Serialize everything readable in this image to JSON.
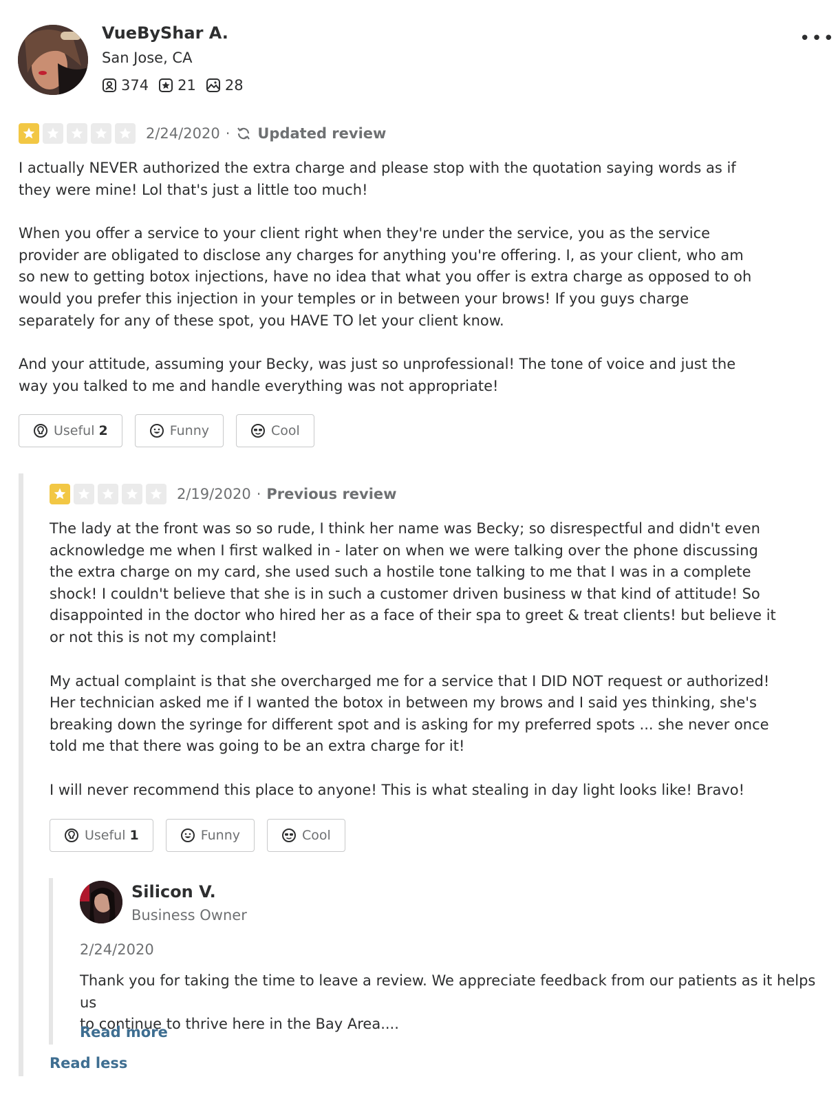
{
  "user": {
    "name": "VueByShar A.",
    "location": "San Jose, CA",
    "friends": "374",
    "reviews": "21",
    "photos": "28",
    "friends_icon": "friends-icon",
    "reviews_icon": "review-star-icon",
    "photos_icon": "photo-icon",
    "more_icon": "more-options-icon"
  },
  "colors": {
    "star_on": "#f2c744",
    "star_off": "#ebebeb",
    "link": "#3e6e91",
    "muted": "#6e7072"
  },
  "updated_review": {
    "rating": 1,
    "date": "2/24/2020",
    "label": "Updated review",
    "paragraphs": [
      "I actually NEVER authorized the extra charge and please stop with the quotation saying words as if\nthey were mine! Lol that's just a little too much!",
      "When you offer a service to your client right when they're under the service, you as the service\nprovider are obligated to disclose any charges for anything you're offering. I, as your client, who am\nso new to getting botox injections, have no idea that what you offer is extra charge as opposed to oh\nwould you prefer this injection in your temples or in between your brows! If you guys charge\nseparately for any of these spot, you HAVE TO let your client know.",
      "And your attitude, assuming your Becky, was just so unprofessional! The tone of voice and just the\nway you talked to me and handle everything was not appropriate!"
    ],
    "buttons": {
      "useful_label": "Useful",
      "useful_count": "2",
      "funny_label": "Funny",
      "cool_label": "Cool"
    }
  },
  "previous_review": {
    "rating": 1,
    "date": "2/19/2020",
    "label": "Previous review",
    "paragraphs": [
      "The lady at the front was so so rude, I think her name was Becky; so disrespectful and didn't even\nacknowledge me when I first walked in - later on when we were talking over the phone discussing\nthe extra charge on my card, she used such a hostile tone talking to me that I was in a complete\nshock! I couldn't believe that she is in such a customer driven business w that kind of attitude! So\ndisappointed in the doctor who hired her as a face of their spa to greet & treat clients! but believe it\nor not this is not my complaint!",
      "My actual complaint is that she overcharged me for a service that I DID NOT request or authorized!\nHer technician asked me if I wanted the botox in between my brows and I said yes thinking, she's\nbreaking down the syringe for different spot and is asking for my preferred spots ... she never once\ntold me that there was going to be an extra charge for it!",
      "I will never recommend this place to anyone! This is what stealing in day light looks like! Bravo!"
    ],
    "buttons": {
      "useful_label": "Useful",
      "useful_count": "1",
      "funny_label": "Funny",
      "cool_label": "Cool"
    }
  },
  "owner_reply": {
    "name": "Silicon V.",
    "role": "Business Owner",
    "date": "2/24/2020",
    "text": "Thank you for taking the time to leave a review. We appreciate feedback from our patients as it helps us\nto continue to thrive here in the Bay Area....",
    "read_more": "Read more"
  },
  "read_less": "Read less"
}
